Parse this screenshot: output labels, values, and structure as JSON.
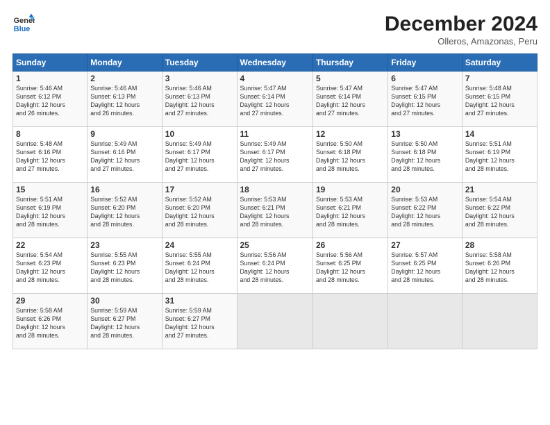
{
  "header": {
    "logo_line1": "General",
    "logo_line2": "Blue",
    "month": "December 2024",
    "location": "Olleros, Amazonas, Peru"
  },
  "days_of_week": [
    "Sunday",
    "Monday",
    "Tuesday",
    "Wednesday",
    "Thursday",
    "Friday",
    "Saturday"
  ],
  "weeks": [
    [
      {
        "day": "1",
        "info": "Sunrise: 5:46 AM\nSunset: 6:12 PM\nDaylight: 12 hours\nand 26 minutes."
      },
      {
        "day": "2",
        "info": "Sunrise: 5:46 AM\nSunset: 6:13 PM\nDaylight: 12 hours\nand 26 minutes."
      },
      {
        "day": "3",
        "info": "Sunrise: 5:46 AM\nSunset: 6:13 PM\nDaylight: 12 hours\nand 27 minutes."
      },
      {
        "day": "4",
        "info": "Sunrise: 5:47 AM\nSunset: 6:14 PM\nDaylight: 12 hours\nand 27 minutes."
      },
      {
        "day": "5",
        "info": "Sunrise: 5:47 AM\nSunset: 6:14 PM\nDaylight: 12 hours\nand 27 minutes."
      },
      {
        "day": "6",
        "info": "Sunrise: 5:47 AM\nSunset: 6:15 PM\nDaylight: 12 hours\nand 27 minutes."
      },
      {
        "day": "7",
        "info": "Sunrise: 5:48 AM\nSunset: 6:15 PM\nDaylight: 12 hours\nand 27 minutes."
      }
    ],
    [
      {
        "day": "8",
        "info": "Sunrise: 5:48 AM\nSunset: 6:16 PM\nDaylight: 12 hours\nand 27 minutes."
      },
      {
        "day": "9",
        "info": "Sunrise: 5:49 AM\nSunset: 6:16 PM\nDaylight: 12 hours\nand 27 minutes."
      },
      {
        "day": "10",
        "info": "Sunrise: 5:49 AM\nSunset: 6:17 PM\nDaylight: 12 hours\nand 27 minutes."
      },
      {
        "day": "11",
        "info": "Sunrise: 5:49 AM\nSunset: 6:17 PM\nDaylight: 12 hours\nand 27 minutes."
      },
      {
        "day": "12",
        "info": "Sunrise: 5:50 AM\nSunset: 6:18 PM\nDaylight: 12 hours\nand 28 minutes."
      },
      {
        "day": "13",
        "info": "Sunrise: 5:50 AM\nSunset: 6:18 PM\nDaylight: 12 hours\nand 28 minutes."
      },
      {
        "day": "14",
        "info": "Sunrise: 5:51 AM\nSunset: 6:19 PM\nDaylight: 12 hours\nand 28 minutes."
      }
    ],
    [
      {
        "day": "15",
        "info": "Sunrise: 5:51 AM\nSunset: 6:19 PM\nDaylight: 12 hours\nand 28 minutes."
      },
      {
        "day": "16",
        "info": "Sunrise: 5:52 AM\nSunset: 6:20 PM\nDaylight: 12 hours\nand 28 minutes."
      },
      {
        "day": "17",
        "info": "Sunrise: 5:52 AM\nSunset: 6:20 PM\nDaylight: 12 hours\nand 28 minutes."
      },
      {
        "day": "18",
        "info": "Sunrise: 5:53 AM\nSunset: 6:21 PM\nDaylight: 12 hours\nand 28 minutes."
      },
      {
        "day": "19",
        "info": "Sunrise: 5:53 AM\nSunset: 6:21 PM\nDaylight: 12 hours\nand 28 minutes."
      },
      {
        "day": "20",
        "info": "Sunrise: 5:53 AM\nSunset: 6:22 PM\nDaylight: 12 hours\nand 28 minutes."
      },
      {
        "day": "21",
        "info": "Sunrise: 5:54 AM\nSunset: 6:22 PM\nDaylight: 12 hours\nand 28 minutes."
      }
    ],
    [
      {
        "day": "22",
        "info": "Sunrise: 5:54 AM\nSunset: 6:23 PM\nDaylight: 12 hours\nand 28 minutes."
      },
      {
        "day": "23",
        "info": "Sunrise: 5:55 AM\nSunset: 6:23 PM\nDaylight: 12 hours\nand 28 minutes."
      },
      {
        "day": "24",
        "info": "Sunrise: 5:55 AM\nSunset: 6:24 PM\nDaylight: 12 hours\nand 28 minutes."
      },
      {
        "day": "25",
        "info": "Sunrise: 5:56 AM\nSunset: 6:24 PM\nDaylight: 12 hours\nand 28 minutes."
      },
      {
        "day": "26",
        "info": "Sunrise: 5:56 AM\nSunset: 6:25 PM\nDaylight: 12 hours\nand 28 minutes."
      },
      {
        "day": "27",
        "info": "Sunrise: 5:57 AM\nSunset: 6:25 PM\nDaylight: 12 hours\nand 28 minutes."
      },
      {
        "day": "28",
        "info": "Sunrise: 5:58 AM\nSunset: 6:26 PM\nDaylight: 12 hours\nand 28 minutes."
      }
    ],
    [
      {
        "day": "29",
        "info": "Sunrise: 5:58 AM\nSunset: 6:26 PM\nDaylight: 12 hours\nand 28 minutes."
      },
      {
        "day": "30",
        "info": "Sunrise: 5:59 AM\nSunset: 6:27 PM\nDaylight: 12 hours\nand 28 minutes."
      },
      {
        "day": "31",
        "info": "Sunrise: 5:59 AM\nSunset: 6:27 PM\nDaylight: 12 hours\nand 27 minutes."
      },
      {
        "day": "",
        "info": ""
      },
      {
        "day": "",
        "info": ""
      },
      {
        "day": "",
        "info": ""
      },
      {
        "day": "",
        "info": ""
      }
    ]
  ]
}
